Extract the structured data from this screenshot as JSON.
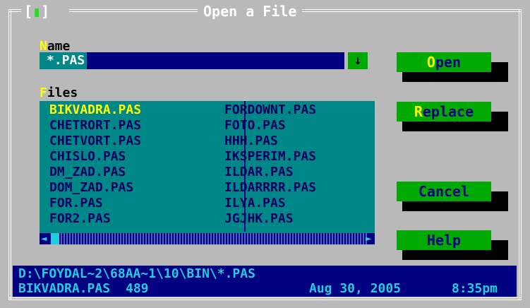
{
  "window": {
    "title": "Open a File",
    "close_box": {
      "left": "[",
      "mark": "▮",
      "right": "]"
    }
  },
  "name_field": {
    "label_hotkey": "N",
    "label_rest": "ame",
    "value": "*.PAS",
    "history_icon": "↓"
  },
  "files": {
    "label_hotkey": "F",
    "label_rest": "iles",
    "column1": [
      "BIKVADRA.PAS",
      "CHETRORT.PAS",
      "CHETVORT.PAS",
      "CHISLO.PAS",
      "DM_ZAD.PAS",
      "DOM_ZAD.PAS",
      "FOR.PAS",
      "FOR2.PAS"
    ],
    "column2": [
      "FORDOWNT.PAS",
      "FOTO.PAS",
      "HHH.PAS",
      "IKSPERIM.PAS",
      "ILDAR.PAS",
      "ILDARRRR.PAS",
      "ILYA.PAS",
      "JGJHK.PAS"
    ],
    "focused": "BIKVADRA.PAS",
    "scroll_left_icon": "◄",
    "scroll_right_icon": "►"
  },
  "buttons": {
    "open": {
      "hotkey": "O",
      "rest": "pen"
    },
    "replace": {
      "hotkey": "R",
      "rest": "eplace"
    },
    "cancel": {
      "label": "Cancel"
    },
    "help": {
      "label": "Help"
    }
  },
  "info": {
    "path": "D:\\FOYDAL~2\\68AA~1\\10\\BIN\\*.PAS",
    "file_name": "BIKVADRA.PAS",
    "file_size": "489",
    "date": "Aug 30, 2005",
    "time": "8:35pm"
  },
  "colors": {
    "dialog_bg": "#b9b9b9",
    "list_bg": "#008888",
    "input_bg": "#000080",
    "button_bg": "#00aa00",
    "hotkey": "#ffff00",
    "info_text": "#22ccdd"
  }
}
